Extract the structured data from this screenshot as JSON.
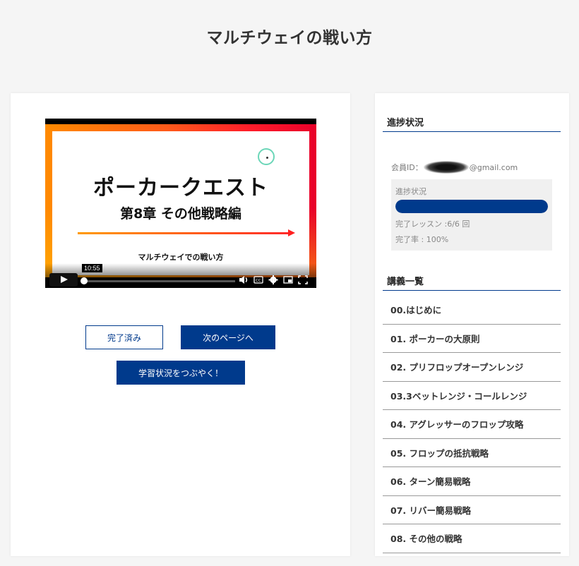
{
  "page": {
    "title": "マルチウェイの戦い方"
  },
  "video": {
    "slide_title": "ポーカークエスト",
    "slide_subtitle": "第8章 その他戦略編",
    "slide_caption": "マルチウェイでの戦い方",
    "time_tooltip": "10:55",
    "progress_fraction": 0.0
  },
  "actions": {
    "completed_label": "完了済み",
    "next_label": "次のページへ",
    "tweet_label": "学習状況をつぶやく！"
  },
  "sidebar": {
    "progress_heading": "進捗状況",
    "member_label": "会員ID：",
    "member_suffix": "@gmail.com",
    "progress_label": "進捗状況",
    "progress_percent": 100,
    "completed_lessons": "完了レッスン :6/6 回",
    "completion_rate": "完了率 : 100%",
    "lessons_heading": "講義一覧",
    "lessons": [
      {
        "label": "00.はじめに"
      },
      {
        "label": "01. ポーカーの大原則"
      },
      {
        "label": "02. プリフロップオープンレンジ"
      },
      {
        "label": "03.3ベットレンジ・コールレンジ"
      },
      {
        "label": "04. アグレッサーのフロップ攻略"
      },
      {
        "label": "05. フロップの抵抗戦略"
      },
      {
        "label": "06. ターン簡易戦略"
      },
      {
        "label": "07. リバー簡易戦略"
      },
      {
        "label": "08. その他の戦略"
      }
    ]
  },
  "colors": {
    "accent": "#003a8c",
    "page_bg": "#f5f5f5"
  }
}
